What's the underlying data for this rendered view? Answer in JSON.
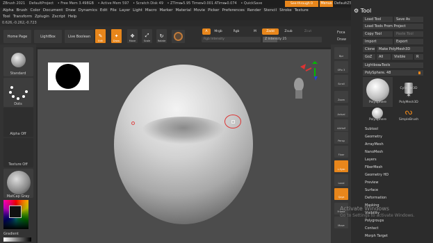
{
  "titlebar": {
    "app": "ZBrush 2021",
    "project": "DefaultProject",
    "free_mem": "• Free Mem 3.498GB",
    "active_mem": "• Active Mem 597",
    "scratch": "• Scratch Disk 49",
    "ztime": "• ZTime▸5.95 Timer▸0.001 ATime▸0.074",
    "quicksave": "• QuickSave",
    "seethrough": "See-through 0",
    "menus_label": "Menus",
    "script": "DefaultZScript"
  },
  "menu": {
    "row1": [
      "Alpha",
      "Brush",
      "Color",
      "Document",
      "Draw",
      "Dynamics",
      "Edit",
      "File",
      "Layer",
      "Light",
      "Macro",
      "Marker",
      "Material",
      "Movie",
      "Picker",
      "Preferences",
      "Render",
      "Stencil",
      "Stroke",
      "Texture"
    ],
    "row2": [
      "Tool",
      "Transform",
      "Zplugin",
      "Zscript",
      "Help"
    ]
  },
  "coords": "0.626,-0.262,-0.723",
  "shelf": {
    "home": "Home Page",
    "lightbox": "LightBox",
    "livebool": "Live Boolean",
    "edit": "Edit",
    "draw": "Draw",
    "move": "Move",
    "scale": "Scale",
    "rotate": "Rotate"
  },
  "brushbar": {
    "a": "A",
    "mrgb": "Mrgb",
    "rgb": "Rgb",
    "m": "M",
    "zadd": "Zadd",
    "zsub": "Zsub",
    "zcut": "Zcut",
    "rgb_intensity": "Rgb Intensity",
    "z_intensity": "Z Intensity 25"
  },
  "focal": {
    "label": "Foca",
    "draw": "Draw"
  },
  "left": {
    "standard": "Standard",
    "dots": "Dots",
    "alpha_off": "Alpha Off",
    "texture_off": "Texture Off",
    "matcap": "MatCap Gray",
    "gradient": "Gradient"
  },
  "rightstrip": [
    "Bpr",
    "SPix 3",
    "Scroll",
    "Zoom",
    "Actual",
    "AAHalf",
    "Persp",
    "Floor",
    "L.Sym",
    "Local",
    "Qxyz",
    "Frame",
    "Move"
  ],
  "tool": {
    "title": "Tool",
    "load": "Load Tool",
    "save_as": "Save As",
    "load_project": "Load Tools From Project",
    "copy": "Copy Tool",
    "paste": "Paste Tool",
    "import": "Import",
    "export": "Export",
    "clone": "Clone",
    "make_polymesh": "Make PolyMesh3D",
    "goz": "GoZ",
    "all": "All",
    "visible": "Visible",
    "r": "R",
    "lightbox_tools": "Lightbox▸Tools",
    "polysphere_slider": "PolySphere. 48",
    "thumbs": [
      "PolySphere",
      "Cylinder3D",
      "PolyMesh3D",
      "PolySphere",
      "SimpleBrush"
    ],
    "items": [
      "Subtool",
      "Geometry",
      "ArrayMesh",
      "NanoMesh",
      "Layers",
      "FiberMesh",
      "Geometry HD",
      "Preview",
      "Surface",
      "Deformation",
      "Masking",
      "Visibility",
      "Polygroups",
      "Contact",
      "Morph Target"
    ]
  },
  "watermark": {
    "line1": "Activate Windows",
    "line2": "Go to Settings to activate Windows."
  },
  "colors": {
    "accent": "#e8861b",
    "canvas": "#4c4c4c"
  }
}
